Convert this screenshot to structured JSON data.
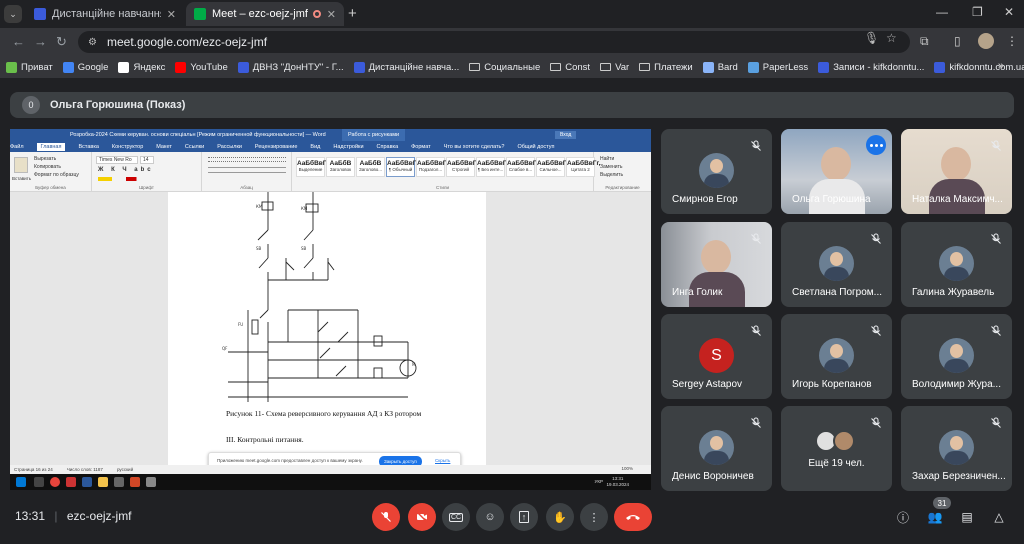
{
  "browser": {
    "tabs": [
      {
        "title": "Дистанційне навчання в ВСП",
        "favicon_color": "#3b5bdb",
        "active": false
      },
      {
        "title": "Meet – ezc-oejz-jmf",
        "favicon_color": "#00ac47",
        "active": true
      }
    ],
    "url": "meet.google.com/ezc-oejz-jmf",
    "bookmarks": [
      {
        "label": "Приват",
        "icon": "privat-icon",
        "color": "#6abf4b"
      },
      {
        "label": "Google",
        "icon": "google-icon",
        "color": "#4285f4"
      },
      {
        "label": "Яндекс",
        "icon": "star-icon",
        "color": "#ffffff"
      },
      {
        "label": "YouTube",
        "icon": "youtube-icon",
        "color": "#ff0000"
      },
      {
        "label": "ДВНЗ \"ДонНТУ\" - Г...",
        "icon": "site-icon",
        "color": "#3b5bdb"
      },
      {
        "label": "Дистанційне навча...",
        "icon": "site-icon",
        "color": "#3b5bdb"
      },
      {
        "label": "Социальные",
        "icon": "folder-icon",
        "color": ""
      },
      {
        "label": "Const",
        "icon": "folder-icon",
        "color": ""
      },
      {
        "label": "Var",
        "icon": "folder-icon",
        "color": ""
      },
      {
        "label": "Платежи",
        "icon": "folder-icon",
        "color": ""
      },
      {
        "label": "Bard",
        "icon": "bard-icon",
        "color": "#8ab4f8"
      },
      {
        "label": "PaperLess",
        "icon": "paperless-icon",
        "color": "#5aa0e0"
      },
      {
        "label": "Записи - kifkdonntu...",
        "icon": "site-icon",
        "color": "#3b5bdb"
      },
      {
        "label": "kifkdonntu.com.ua",
        "icon": "site-icon",
        "color": "#3b5bdb"
      }
    ]
  },
  "presenter": {
    "count": "0",
    "label": "Ольга Горюшина (Показ)"
  },
  "shared_screen": {
    "title": "Розробка-2024 Схеми керуван. основи спеціальн [Режим ограниченной функциональности] — Word",
    "context_tab": "Работа с рисунками",
    "signin": "Вход",
    "menu": [
      "Файл",
      "Главная",
      "Вставка",
      "Конструктор",
      "Макет",
      "Ссылки",
      "Рассылки",
      "Рецензирование",
      "Вид",
      "Надстройки",
      "Справка",
      "Формат",
      "Что вы хотите сделать?",
      "Общий доступ"
    ],
    "ribbon": {
      "paste": "Вставить",
      "cut": "Вырезать",
      "copy": "Копировать",
      "format_painter": "Формат по образцу",
      "font": "Times New Ro",
      "size": "14",
      "groups": [
        "Буфер обмена",
        "Шрифт",
        "Абзац",
        "Стили",
        "Редактирование"
      ],
      "styles": [
        {
          "sample": "АаБбВвГг,",
          "name": "Выделение"
        },
        {
          "sample": "АаБбВ",
          "name": "Заголовок"
        },
        {
          "sample": "АаБбВ",
          "name": "Заголово..."
        },
        {
          "sample": "АаБбВвГг,",
          "name": "¶ Обычный"
        },
        {
          "sample": "АаБбВвГ",
          "name": "Подзагол..."
        },
        {
          "sample": "АаБбВвГг",
          "name": "Строгий"
        },
        {
          "sample": "АаБбВвГг,",
          "name": "¶ Без инте..."
        },
        {
          "sample": "АаБбВвГг,",
          "name": "Слабое в..."
        },
        {
          "sample": "АаБбВвГг,",
          "name": "Сильное..."
        },
        {
          "sample": "АаБбВвГг,",
          "name": "Цитата 2"
        }
      ],
      "edit": [
        "Найти",
        "Заменить",
        "Выделить"
      ]
    },
    "caption": "Рисунок 11- Схема  реверсивного керування АД з КЗ ротором",
    "section": "III. Контрольні питання.",
    "status": {
      "page": "Страница 16 из 24",
      "words": "Число слов: 1187",
      "lang": "русский",
      "zoom": "100%"
    },
    "notice": {
      "text": "Приложению meet.google.com предоставлен доступ к вашему экрану.",
      "button": "Закрыть доступ",
      "hide": "Скрыть"
    },
    "taskbar": {
      "lang": "УКР",
      "time": "13:31",
      "date": "19.03.2024"
    }
  },
  "participants": [
    {
      "name": "Смирнов Егор",
      "type": "avatar",
      "muted": true
    },
    {
      "name": "Ольга Горюшина",
      "type": "video",
      "muted": false,
      "speaking": true
    },
    {
      "name": "Наталка Максимч...",
      "type": "video",
      "muted": true
    },
    {
      "name": "Инга Голик",
      "type": "video",
      "muted": true
    },
    {
      "name": "Светлана Погром...",
      "type": "avatar",
      "muted": true
    },
    {
      "name": "Галина Журавель",
      "type": "avatar",
      "muted": true
    },
    {
      "name": "Sergey Astapov",
      "type": "letter",
      "letter": "S",
      "muted": true
    },
    {
      "name": "Игорь Корепанов",
      "type": "avatar",
      "muted": true
    },
    {
      "name": "Володимир Жура...",
      "type": "avatar",
      "muted": true
    },
    {
      "name": "Денис Вороничев",
      "type": "avatar",
      "muted": true
    },
    {
      "name": "Ещё 19 чел.",
      "type": "more",
      "muted": true
    },
    {
      "name": "Захар Березничен...",
      "type": "avatar",
      "muted": true
    }
  ],
  "bottom_bar": {
    "time": "13:31",
    "meeting_code": "ezc-oejz-jmf",
    "people_count": "31",
    "accent_red": "#ea4335"
  }
}
